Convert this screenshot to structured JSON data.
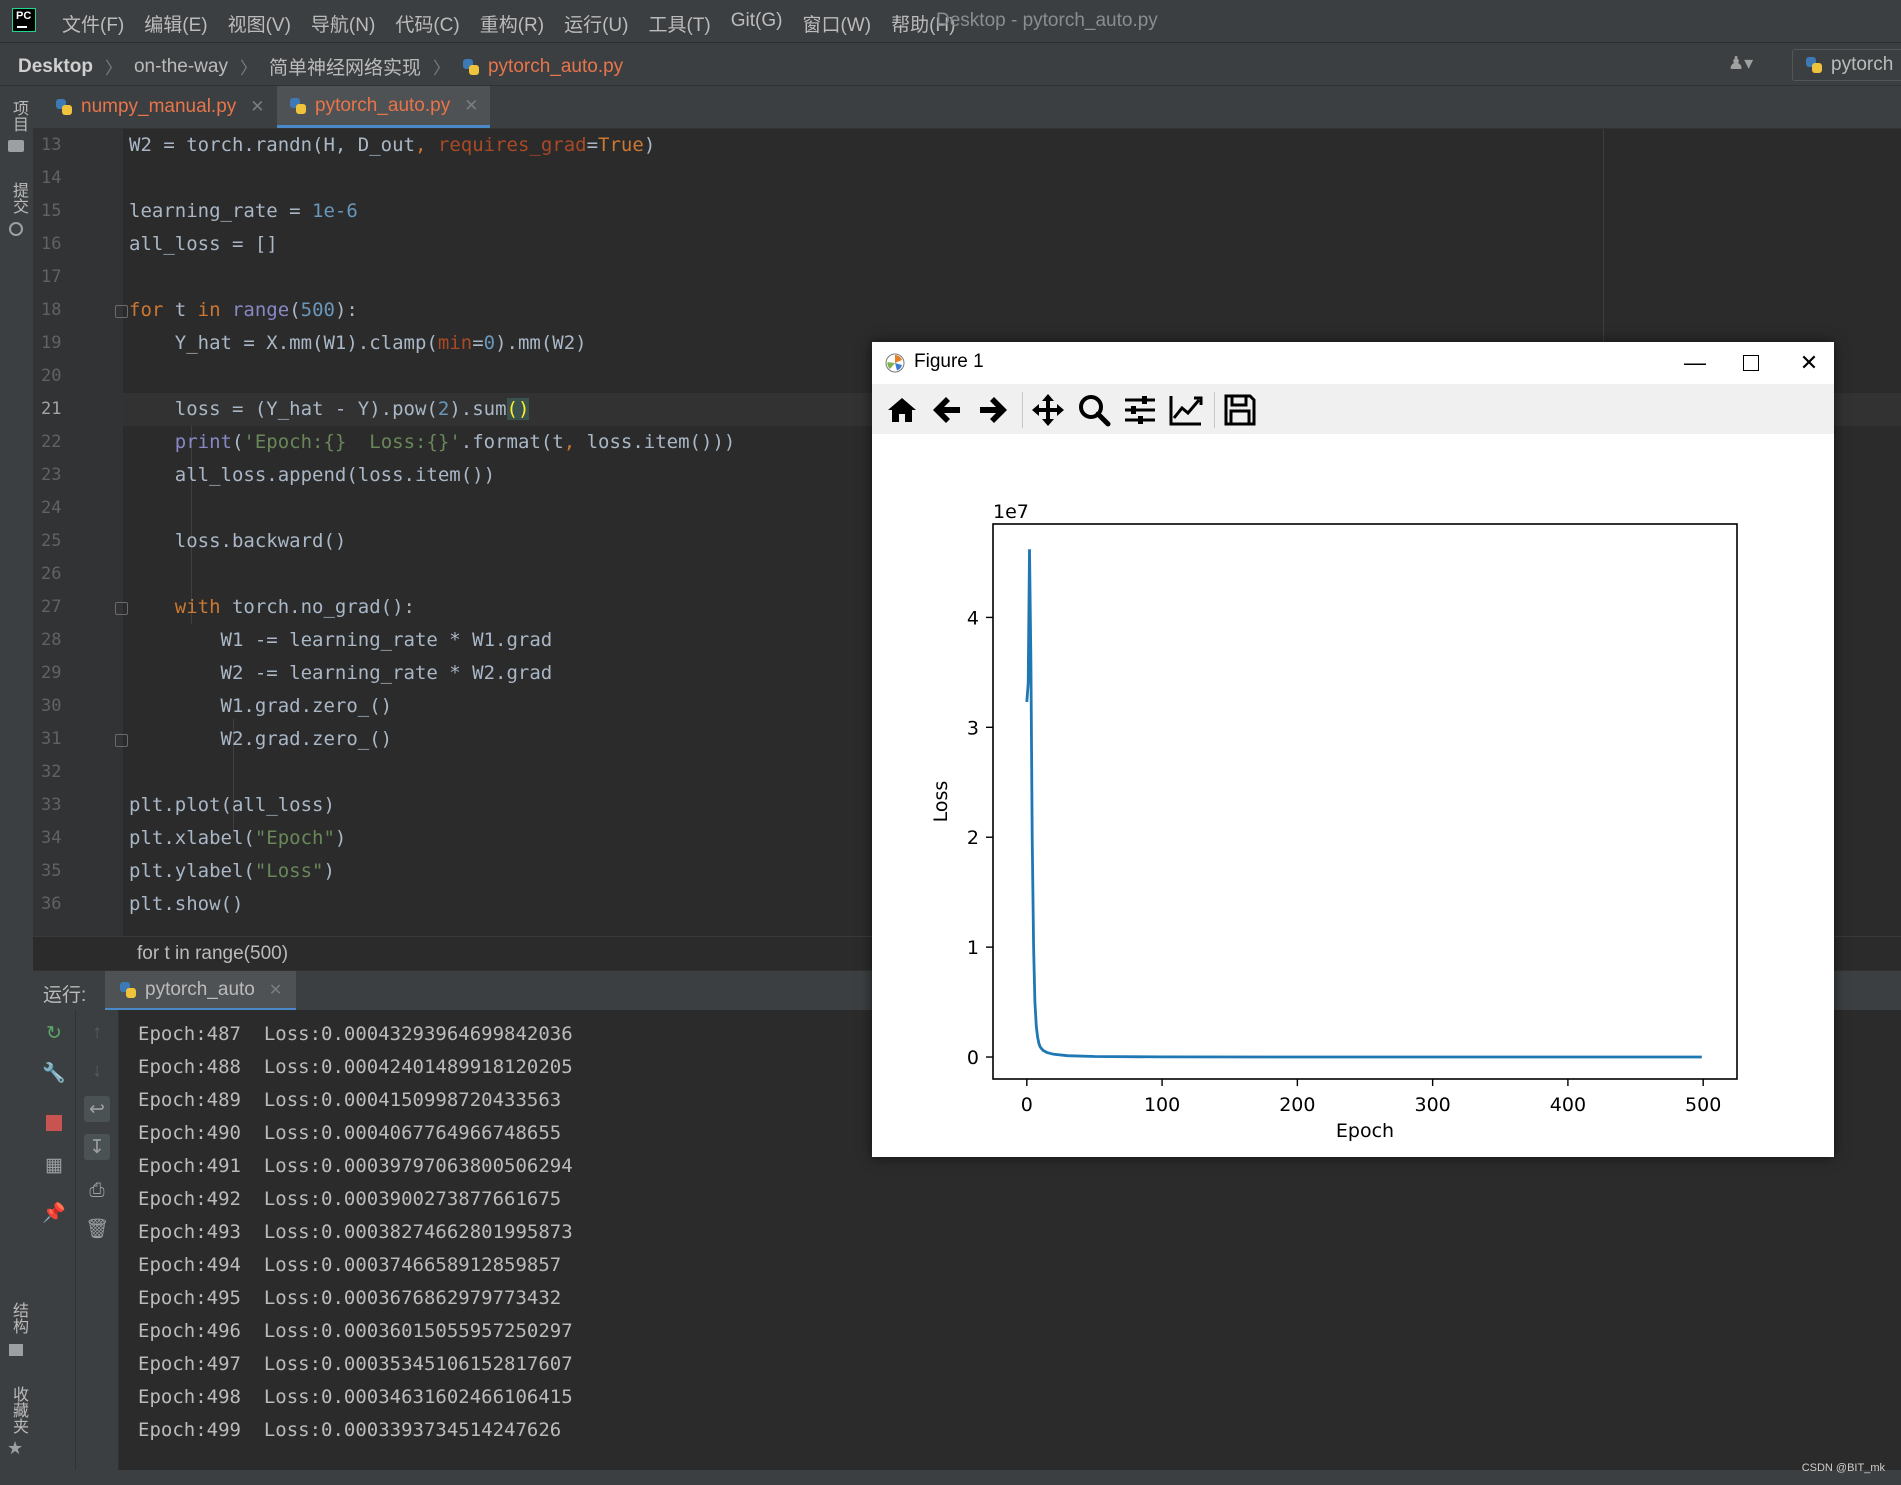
{
  "menubar": {
    "logo_text": "PC",
    "items": [
      "文件(F)",
      "编辑(E)",
      "视图(V)",
      "导航(N)",
      "代码(C)",
      "重构(R)",
      "运行(U)",
      "工具(T)",
      "Git(G)",
      "窗口(W)",
      "帮助(H)"
    ],
    "window_title": "Desktop - pytorch_auto.py"
  },
  "navbar": {
    "crumbs": [
      "Desktop",
      "on-the-way",
      "简单神经网络实现",
      "pytorch_auto.py"
    ],
    "run_config": "pytorch"
  },
  "left_strip": {
    "project": "项目",
    "commit": "提交",
    "structure": "结构",
    "favorites": "收藏夹"
  },
  "tabs": [
    {
      "label": "numpy_manual.py"
    },
    {
      "label": "pytorch_auto.py",
      "active": true
    }
  ],
  "editor": {
    "current_line": 21,
    "lines": [
      {
        "n": 13,
        "html": "W2 = torch.randn(H, D_out<span class='kw'>, </span><span class='prm'>requires_grad</span>=<span class='kw'>True</span>)"
      },
      {
        "n": 14,
        "html": ""
      },
      {
        "n": 15,
        "html": "learning_rate = <span class='num'>1e-6</span>"
      },
      {
        "n": 16,
        "html": "all_loss = []"
      },
      {
        "n": 17,
        "html": ""
      },
      {
        "n": 18,
        "html": "<span class='kw'>for </span>t <span class='kw'>in </span><span class='bi'>range</span>(<span class='num'>500</span>):",
        "fold": true
      },
      {
        "n": 19,
        "html": "    Y_hat = X.mm(W1).clamp(<span class='prm'>min</span>=<span class='num'>0</span>).mm(W2)"
      },
      {
        "n": 20,
        "html": ""
      },
      {
        "n": 21,
        "html": "    loss = (Y_hat - Y).pow(<span class='num'>2</span>).sum<span class='br'>()</span>"
      },
      {
        "n": 22,
        "html": "    <span class='bi'>print</span>(<span class='str'>'Epoch:{}  Loss:{}'</span>.format(t<span class='kw'>, </span>loss.item()))"
      },
      {
        "n": 23,
        "html": "    all_loss.append(loss.item())"
      },
      {
        "n": 24,
        "html": ""
      },
      {
        "n": 25,
        "html": "    loss.backward()"
      },
      {
        "n": 26,
        "html": ""
      },
      {
        "n": 27,
        "html": "    <span class='kw'>with </span>torch.no_grad():",
        "fold": true
      },
      {
        "n": 28,
        "html": "        W1 -= learning_rate * W1.grad"
      },
      {
        "n": 29,
        "html": "        W2 -= learning_rate * W2.grad"
      },
      {
        "n": 30,
        "html": "        W1.grad.zero_()"
      },
      {
        "n": 31,
        "html": "        W2.grad.zero_()",
        "fold": true
      },
      {
        "n": 32,
        "html": ""
      },
      {
        "n": 33,
        "html": "plt.plot(all_loss)"
      },
      {
        "n": 34,
        "html": "plt.xlabel(<span class='str'>\"Epoch\"</span>)"
      },
      {
        "n": 35,
        "html": "plt.ylabel(<span class='str'>\"Loss\"</span>)"
      },
      {
        "n": 36,
        "html": "plt.show()"
      }
    ]
  },
  "code_breadcrumb": "for t in range(500)",
  "run": {
    "label": "运行:",
    "tab_label": "pytorch_auto",
    "console": [
      "Epoch:487  Loss:0.00043293964699842036",
      "Epoch:488  Loss:0.00042401489918120205",
      "Epoch:489  Loss:0.0004150998720433563",
      "Epoch:490  Loss:0.0004067764966748655",
      "Epoch:491  Loss:0.00039797063800506294",
      "Epoch:492  Loss:0.0003900273877661675",
      "Epoch:493  Loss:0.00038274662801995873",
      "Epoch:494  Loss:0.0003746658912859857",
      "Epoch:495  Loss:0.0003676862979773432",
      "Epoch:496  Loss:0.00036015055957250297",
      "Epoch:497  Loss:0.00035345106152817607",
      "Epoch:498  Loss:0.00034631602466106415",
      "Epoch:499  Loss:0.0003393734514247626"
    ]
  },
  "figure": {
    "title": "Figure 1",
    "tools": [
      "home-icon",
      "back-arrow-icon",
      "forward-arrow-icon",
      "pan-icon",
      "zoom-icon",
      "subplots-icon",
      "edit-axis-icon",
      "save-icon"
    ]
  },
  "chart_data": {
    "type": "line",
    "xlabel": "Epoch",
    "ylabel": "Loss",
    "offset_text": "1e7",
    "xlim": [
      -25,
      525
    ],
    "ylim": [
      -0.2,
      4.85
    ],
    "xticks": [
      0,
      100,
      200,
      300,
      400,
      500
    ],
    "yticks": [
      0,
      1,
      2,
      3,
      4
    ],
    "series_color": "#1f77b4",
    "x": [
      0,
      1,
      2,
      3,
      4,
      5,
      6,
      7,
      8,
      9,
      10,
      12,
      15,
      20,
      30,
      50,
      100,
      200,
      300,
      400,
      499
    ],
    "y": [
      3.23,
      3.4,
      4.62,
      3.6,
      2.0,
      1.0,
      0.5,
      0.28,
      0.18,
      0.12,
      0.09,
      0.06,
      0.04,
      0.025,
      0.012,
      0.005,
      0.001,
      0.0,
      0.0,
      0.0,
      0.0
    ]
  },
  "watermark": "CSDN @BIT_mk"
}
